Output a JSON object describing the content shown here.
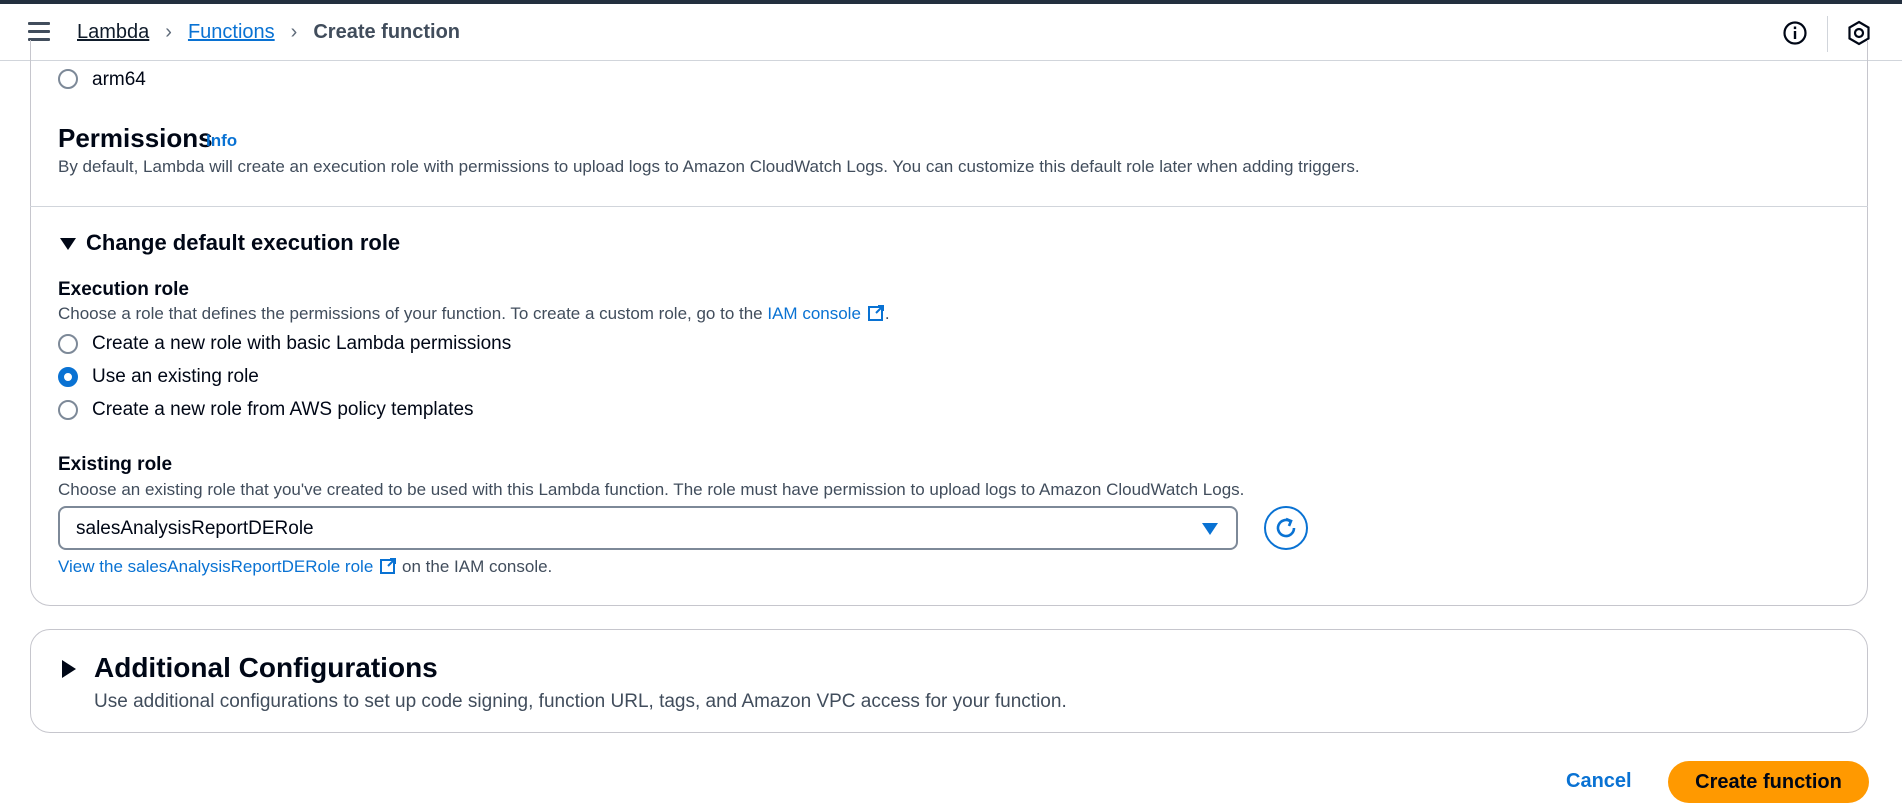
{
  "breadcrumb": {
    "items": [
      "Lambda",
      "Functions"
    ],
    "current": "Create function"
  },
  "icons": {
    "menu": "hamburger-menu-icon",
    "info": "info-circle-icon",
    "notifications": "hexagon-settings-icon",
    "external": "external-link-icon",
    "refresh": "refresh-icon"
  },
  "architecture": {
    "option_arm64": "arm64"
  },
  "permissions": {
    "title": "Permissions",
    "info_link": "Info",
    "description": "By default, Lambda will create an execution role with permissions to upload logs to Amazon CloudWatch Logs. You can customize this default role later when adding triggers."
  },
  "execution_role_section": {
    "toggle_title": "Change default execution role",
    "label": "Execution role",
    "description_prefix": "Choose a role that defines the permissions of your function. To create a custom role, go to the",
    "iam_link": "IAM console",
    "description_suffix": ".",
    "options": [
      {
        "label": "Create a new role with basic Lambda permissions",
        "selected": false
      },
      {
        "label": "Use an existing role",
        "selected": true
      },
      {
        "label": "Create a new role from AWS policy templates",
        "selected": false
      }
    ]
  },
  "existing_role": {
    "label": "Existing role",
    "description": "Choose an existing role that you've created to be used with this Lambda function. The role must have permission to upload logs to Amazon CloudWatch Logs.",
    "selected_value": "salesAnalysisReportDERole",
    "view_link": "View the salesAnalysisReportDERole role",
    "view_suffix": "on the IAM console."
  },
  "additional_config": {
    "title": "Additional Configurations",
    "description": "Use additional configurations to set up code signing, function URL, tags, and Amazon VPC access for your function."
  },
  "actions": {
    "cancel": "Cancel",
    "create": "Create function"
  },
  "colors": {
    "link": "#0972d3",
    "primary_button": "#ff9900",
    "text": "#000716"
  }
}
